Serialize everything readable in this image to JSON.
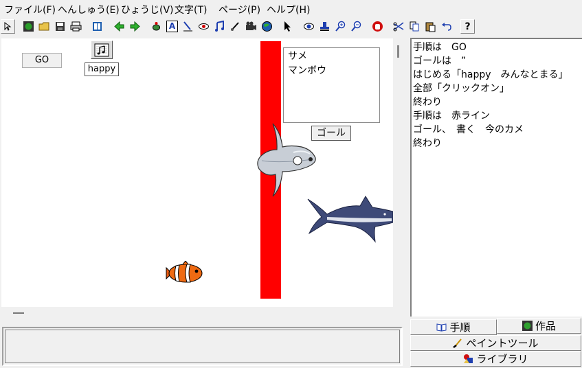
{
  "menu": [
    "ファイル(F)",
    "へんしゅう(E)",
    "ひょうじ(V)",
    "文字(T)",
    "ページ(P)",
    "ヘルプ(H)"
  ],
  "toolbar": {
    "text_icon_label": "A",
    "help_label": "?"
  },
  "stage": {
    "go_label": "GO",
    "happy_label": "happy",
    "list_items": [
      "サメ",
      "マンボウ"
    ],
    "goal_label": "ゴール",
    "line_color": "#ff0000"
  },
  "script": [
    "手順は　GO",
    "ゴールは　”",
    "はじめる「happy　みんなとまる」",
    "全部「クリックオン」",
    "終わり",
    "手順は　赤ライン",
    "ゴール、　書く　今のカメ",
    "終わり"
  ],
  "tabs": {
    "procedure": "手順",
    "works": "作品",
    "paint_tool": "ペイントツール",
    "library": "ライブラリ"
  }
}
